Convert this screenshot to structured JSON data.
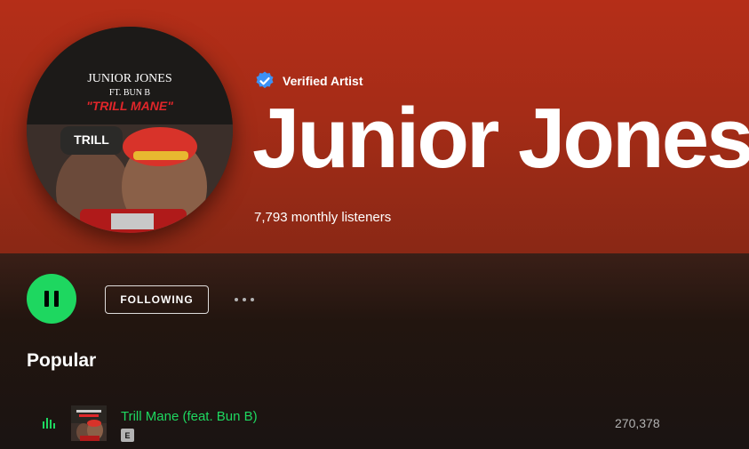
{
  "artist": {
    "verified_label": "Verified Artist",
    "name": "Junior Jones",
    "monthly_listeners": "7,793 monthly listeners",
    "avatar_art": {
      "line1": "JUNIOR JONES",
      "line2": "FT. BUN B",
      "line3": "\"TRILL MANE\"",
      "cap_text": "TRILL"
    }
  },
  "controls": {
    "following_label": "FOLLOWING"
  },
  "popular": {
    "title": "Popular",
    "tracks": [
      {
        "title": "Trill Mane (feat. Bun B)",
        "explicit": "E",
        "plays": "270,378",
        "is_playing": true
      }
    ]
  },
  "colors": {
    "accent_green": "#1ed760",
    "hero_bg": "#b52e18",
    "verified_blue": "#3d91f4"
  }
}
